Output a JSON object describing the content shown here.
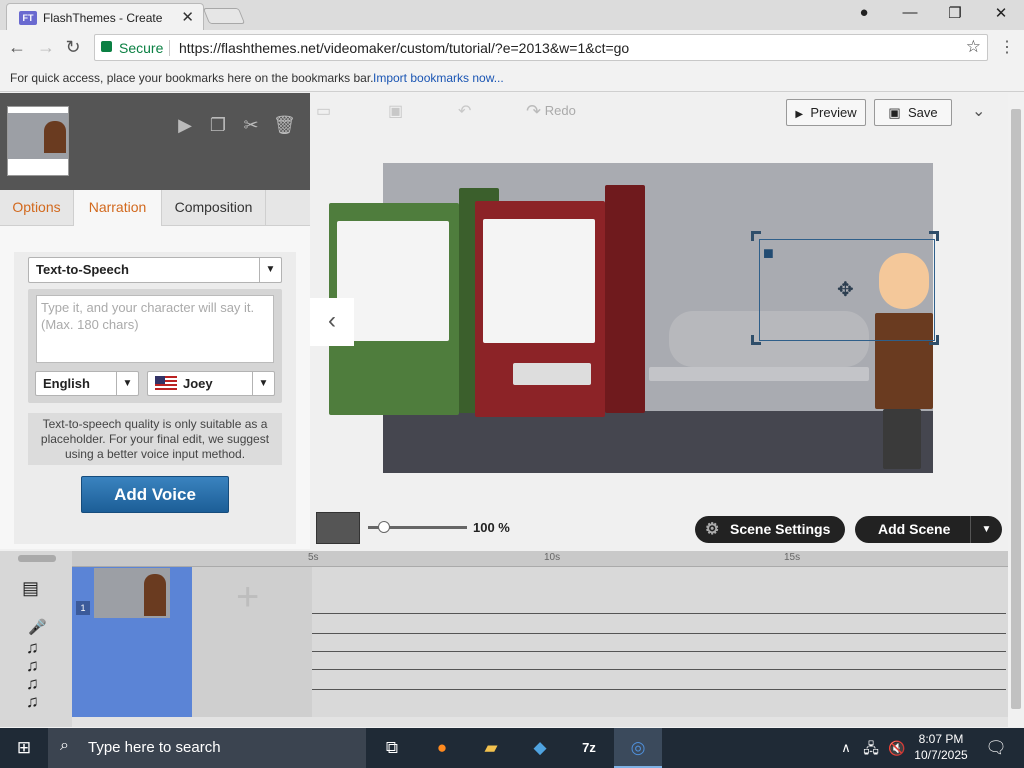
{
  "browser": {
    "tab_title": "FlashThemes - Create",
    "tab_favicon": "FT",
    "secure_label": "Secure",
    "url": "https://flashthemes.net/videomaker/custom/tutorial/?e=2013&w=1&ct=go",
    "bookmarks_hint": "For quick access, place your bookmarks here on the bookmarks bar.",
    "import_link": "Import bookmarks now..."
  },
  "left_panel": {
    "tabs": [
      {
        "label": "Options",
        "active": false
      },
      {
        "label": "Narration",
        "active": true
      },
      {
        "label": "Composition",
        "active": false
      }
    ],
    "voice_method": "Text-to-Speech",
    "tts_placeholder": "Type it, and your character will say it. (Max. 180 chars)",
    "language": "English",
    "voice": "Joey",
    "note": "Text-to-speech quality is only suitable as a placeholder. For your final edit, we suggest using a better voice input method.",
    "add_voice_label": "Add Voice"
  },
  "topbar": {
    "redo_label": "Redo",
    "preview_label": "Preview",
    "save_label": "Save"
  },
  "stage_controls": {
    "zoom_value": "100 %",
    "scene_settings_label": "Scene Settings",
    "add_scene_label": "Add Scene"
  },
  "timeline": {
    "ruler_marks": [
      "5s",
      "10s",
      "15s"
    ],
    "scene_number": "1"
  },
  "taskbar": {
    "search_placeholder": "Type here to search",
    "time": "8:07 PM",
    "date": "10/7/2025"
  },
  "colors": {
    "accent_blue": "#1c5e97",
    "active_tab_text": "#d2691e",
    "secure_green": "#0b8043"
  }
}
